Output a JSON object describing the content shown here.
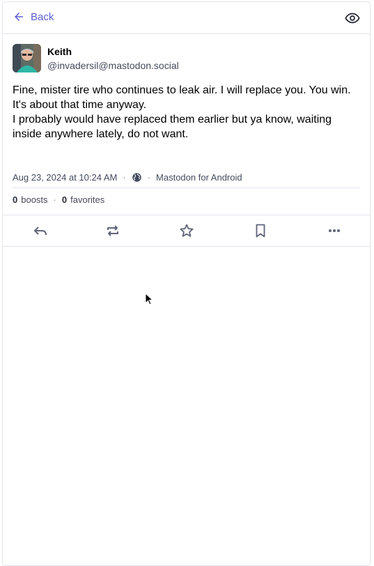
{
  "header": {
    "back_label": "Back",
    "back_icon": "arrow-left-icon",
    "visibility_icon": "eye-icon"
  },
  "status": {
    "author": {
      "display_name": "Keith",
      "handle": "@invadersil@mastodon.social"
    },
    "content": [
      "Fine, mister tire who continues to leak air. I will replace you. You win.",
      "It's about that time anyway.",
      "I probably would have replaced them earlier but ya know, waiting inside anywhere lately, do not want."
    ],
    "meta": {
      "timestamp": "Aug 23, 2024 at 10:24 AM",
      "visibility_icon": "globe-icon",
      "application": "Mastodon for Android",
      "separator": "·"
    },
    "counts": {
      "boosts_value": "0",
      "boosts_label": "boosts",
      "favorites_value": "0",
      "favorites_label": "favorites",
      "separator": "·"
    },
    "actions": [
      "reply-icon",
      "boost-icon",
      "star-icon",
      "bookmark-icon",
      "more-icon"
    ]
  },
  "colors": {
    "accent": "#5c5fd5",
    "muted_text": "#444b5d",
    "border": "#e3e5ec"
  }
}
